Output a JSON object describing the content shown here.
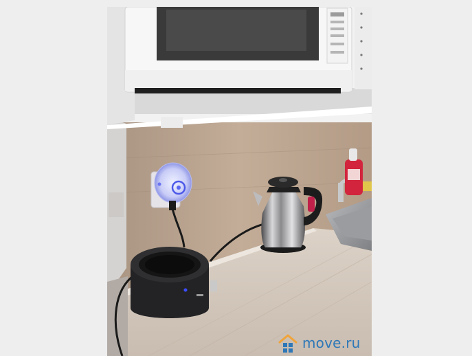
{
  "watermark": {
    "text": "move.ru",
    "icon": "house-logo-icon",
    "brand_color": "#2e78b8",
    "accent_color": "#f0a43a"
  },
  "photo": {
    "objects": [
      "microwave",
      "wall-plug-device",
      "induction-hotplate",
      "electric-kettle",
      "sink",
      "detergent-bottle",
      "countertop",
      "wall-shelf"
    ]
  }
}
